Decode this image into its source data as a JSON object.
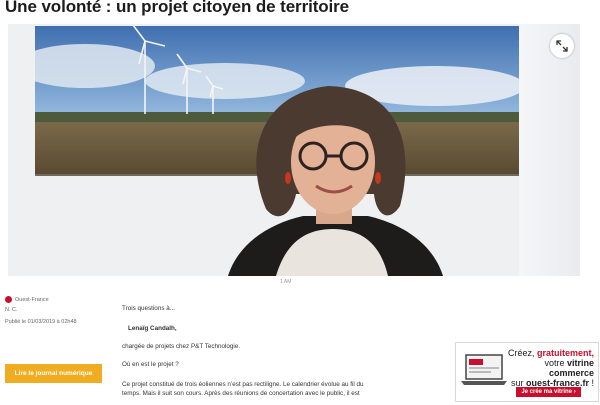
{
  "article": {
    "title": "Une volonté : un projet citoyen de territoire",
    "photo_credit": "1 AM",
    "source": "Ouest-France",
    "author": "N. C.",
    "published": "Publié le 01/03/2019 à 02h48",
    "read_button": "Lire le journal numérique",
    "paragraphs": [
      "Trois questions à...",
      "Lenaïg Candalh,",
      "chargée de projets chez P&T Technologie.",
      "Où en est le projet ?",
      "Ce projet constitué de trois éoliennes n’est pas rectiligne. Le calendrier évolue au fil du temps. Mais il suit son cours. Après des réunions de concertation avec le public, il est"
    ]
  },
  "ad": {
    "line1_prefix": "Créez, ",
    "line1_emph": "gratuitement,",
    "line2_prefix": "votre ",
    "line2_emph": "vitrine commerce",
    "line3_prefix": "sur ",
    "line3_emph": "ouest-france.fr",
    "line3_suffix": " !",
    "cta": "Je crée ma vitrine"
  },
  "colors": {
    "brand_red": "#c8102e",
    "button_yellow": "#f0ad21"
  },
  "icons": {
    "expand": "expand-arrows-icon",
    "source": "ouest-france-logo-icon"
  }
}
